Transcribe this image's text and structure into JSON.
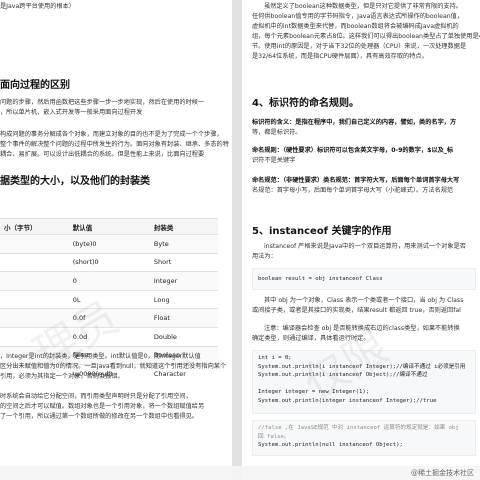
{
  "left": {
    "line_top": "是Java跨平台使用的根本）",
    "heading1": "面向过程的区别",
    "para1": [
      "问题的步骤，然后用函数把这些步骤一步一步地实现，然后在使用的时候一",
      "，所以单片机、嵌入式开发等一般采用面向过程开发",
      "",
      "构成问题的事务分解成各个对象，而建立对象的目的也不是为了完成一个个步骤，",
      "整个事件的解决整个问题的过程中所发生的行为。面向对象有封装、继承、多态的特",
      "耦合、易扩展。可以设计出低耦合的系统。但是性能上来说，比面向过程要"
    ],
    "heading2": "据类型的大小，以及他们的封装类",
    "table": {
      "headers": [
        "小（字节）",
        "默认值",
        "封装类"
      ],
      "rows": [
        [
          "",
          "(byte)0",
          "Byte"
        ],
        [
          "",
          "(short)0",
          "Short"
        ],
        [
          "",
          "0",
          "Integer"
        ],
        [
          "",
          "0L",
          "Long"
        ],
        [
          "",
          "0.0f",
          "Float"
        ],
        [
          "",
          "0.0d",
          "Double"
        ],
        [
          "",
          "false",
          "Boolean"
        ],
        [
          "",
          "\\u0000(null)",
          "Character"
        ]
      ]
    },
    "para2": [
      "，Integer是int的封装类，是引用类型。int默认值是0，而Integer默认值",
      "区分出未赋值和值为0的情况。一旦java看到null，就知道这个引用还没有指向某个",
      "引用，必须为其指定一个对象，否则会报错。",
      "",
      "时系统会自动给它分配空间，而引用类型声明时只是分配了引用空间，",
      "的空间之后才可以赋值。数组对象也是一个引用对象，将一个数组赋值给另",
      "了一个引用，所以通过第一个数组所做的修改在另一个数组中也看得见。"
    ]
  },
  "right": {
    "para1": [
      "虽然定义了boolean这种数据类型，但是只对它提供了非常有限的支持。",
      "任何供boolean值专用的字节码指令，Java语言表达式所操作的boolean值，",
      "虚拟机中的int数据类型来代替，而boolean数组将会被编码成Java虚拟机的",
      "组，每个元素boolean元素占8位。这样我们可以得出boolean类型占了单独使用是4个字",
      "节。使用int的原因是，对于当下32位的处理器（CPU）来说，一次处理数据是",
      "是32/64位系统，而是指CPU硬件层面），具有高效存取的特点。"
    ],
    "heading4": "4、标识符的命名规则。",
    "para2": [
      "标识符的含义：是指在程序中，我们自己定义的内容，譬如，类的名字，方",
      "等，都是标识符。",
      "",
      "命名规则：（硬性要求）标识符可以包含英文字母，0-9的数字，$以及_标",
      "识符不是关键字",
      "",
      "命名规范：（非硬性要求）类名规范：首字符大写，后面每个单词首字母大写",
      "名规范：首字母小写，后面每个单词首字母大写（小驼峰式）。方法名规范"
    ],
    "heading5": "5、instanceof 关键字的作用",
    "para3": [
      "instanceof 严格来说是Java中的一个双目运算符，用来测试一个对象是否",
      "用法为："
    ],
    "code1": "boolean result = obj instanceof Class",
    "para4": [
      "其中 obj 为一个对象，Class 表示一个类或者一个接口，当 obj 为 Class",
      "或间接子类，或者是其接口的实现类，结果result 都返回 true，否则返回fal",
      "",
      "注意：编译器会检查 obj 是否能转换成右边的class类型，如果不能转换",
      "确定类型，则通过编译，具体看运行时定。"
    ],
    "code2": [
      "int i = 0;",
      "System.out.println(i instanceof Integer);//编译不通过  i必须是引用",
      "System.out.println(i instanceof Object);//编译不通过",
      "",
      "Integer integer = new Integer(1);",
      "System.out.println(integer instanceof  Integer);//true"
    ],
    "code3": [
      "//false   ,在 JavaSE规范 中对 instanceof 运算符的规定就是：如果 obj",
      "回 false。",
      "System.out.println(null instanceof Object);"
    ]
  },
  "attribution": "@稀土掘金技术社区"
}
